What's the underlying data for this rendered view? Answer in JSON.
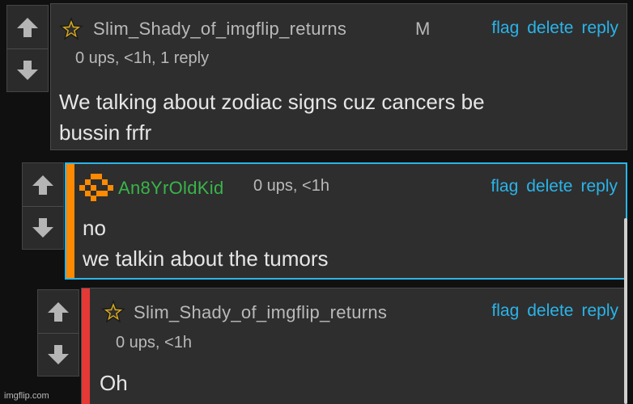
{
  "icons": {
    "vote_up": "arrow-up-icon",
    "vote_down": "arrow-down-icon",
    "star_badge": "star-badge-icon",
    "pixel_avatar": "orange-pixel-avatar-icon"
  },
  "colors": {
    "link": "#2ab4ea",
    "username_gray": "#b9b9b9",
    "username_green": "#39b54a",
    "selected_border": "#29b6e8",
    "stripe_orange": "#ff8a00",
    "stripe_red": "#e53935"
  },
  "comments": [
    {
      "username": "Slim_Shady_of_imgflip_returns",
      "badge": "M",
      "meta": "0 ups, <1h, 1 reply",
      "body": [
        "We talking about zodiac signs cuz cancers be",
        "bussin frfr"
      ],
      "actions": {
        "flag": "flag",
        "delete": "delete",
        "reply": "reply"
      }
    },
    {
      "username": "An8YrOldKid",
      "meta": "0 ups, <1h",
      "body": [
        "no",
        "we talkin about the tumors"
      ],
      "actions": {
        "flag": "flag",
        "delete": "delete",
        "reply": "reply"
      }
    },
    {
      "username": "Slim_Shady_of_imgflip_returns",
      "meta": "0 ups, <1h",
      "body": [
        "Oh"
      ],
      "actions": {
        "flag": "flag",
        "delete": "delete",
        "reply": "reply"
      }
    }
  ],
  "watermark": "imgflip.com"
}
